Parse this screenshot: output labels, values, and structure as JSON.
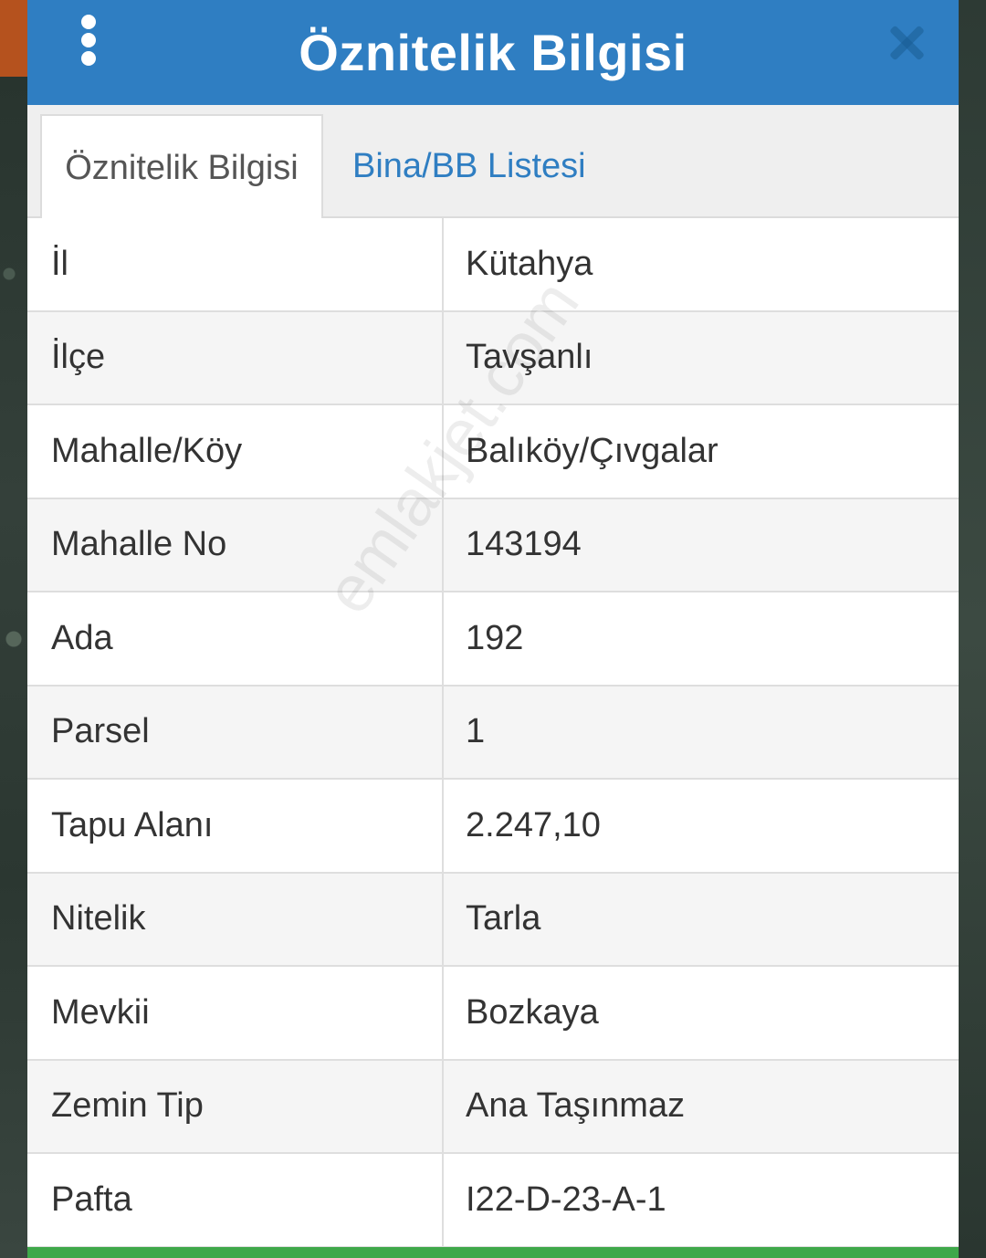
{
  "header": {
    "title": "Öznitelik Bilgisi"
  },
  "tabs": [
    {
      "label": "Öznitelik Bilgisi",
      "active": true
    },
    {
      "label": "Bina/BB Listesi",
      "active": false
    }
  ],
  "attributes": [
    {
      "key": "İl",
      "value": "Kütahya"
    },
    {
      "key": "İlçe",
      "value": "Tavşanlı"
    },
    {
      "key": "Mahalle/Köy",
      "value": "Balıköy/Çıvgalar"
    },
    {
      "key": "Mahalle No",
      "value": "143194"
    },
    {
      "key": "Ada",
      "value": "192"
    },
    {
      "key": "Parsel",
      "value": "1"
    },
    {
      "key": "Tapu Alanı",
      "value": "2.247,10"
    },
    {
      "key": "Nitelik",
      "value": "Tarla"
    },
    {
      "key": "Mevkii",
      "value": "Bozkaya"
    },
    {
      "key": "Zemin Tip",
      "value": "Ana Taşınmaz"
    },
    {
      "key": "Pafta",
      "value": "I22-D-23-A-1"
    }
  ],
  "watermark": "emlakjet.com",
  "colors": {
    "header": "#2f7ec2",
    "tab_link": "#2f7ec2",
    "footer_bar": "#3fa84a"
  },
  "icons": {
    "menu": "more-vertical-icon",
    "close": "close-icon"
  }
}
